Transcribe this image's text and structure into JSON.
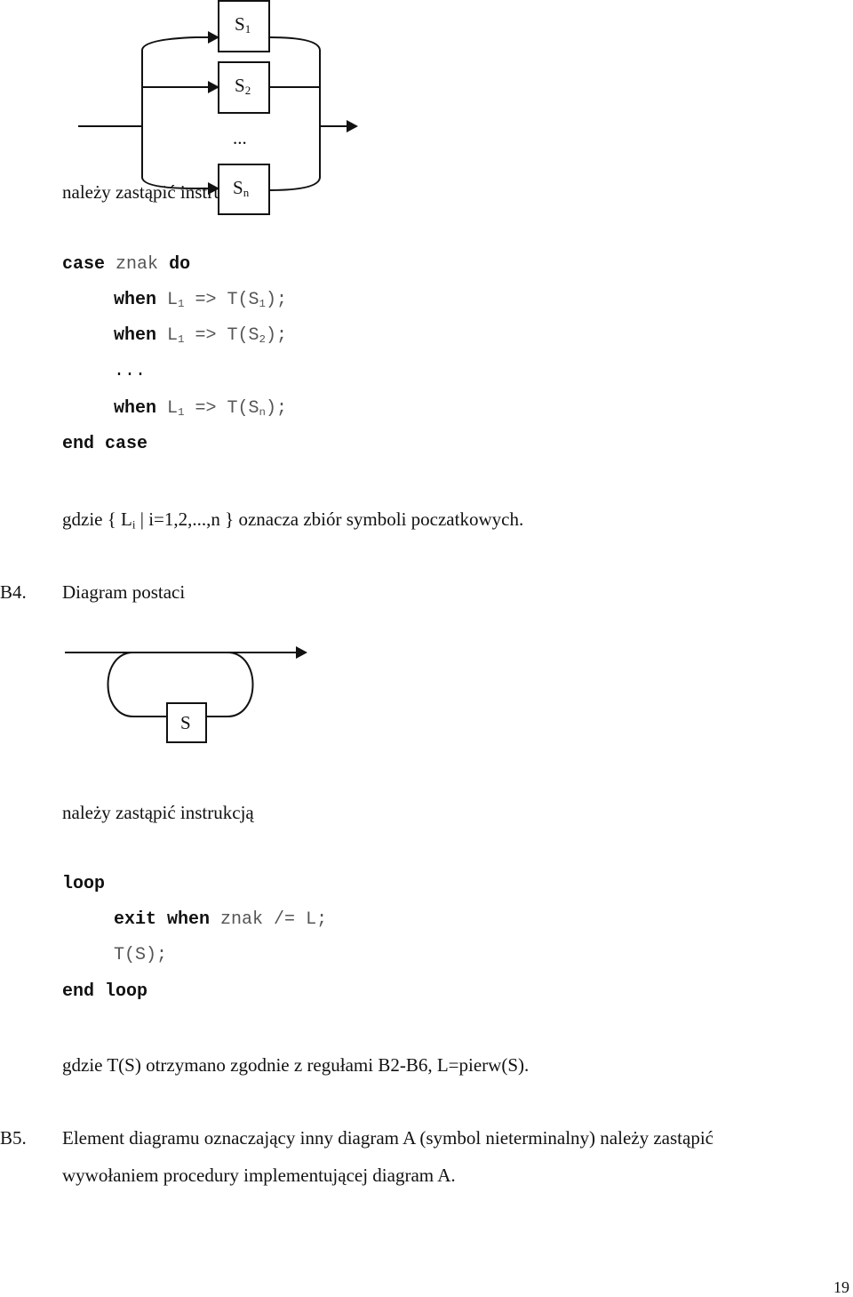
{
  "top_text": {
    "replace_instruction": "należy zastąpić instrukcją"
  },
  "diagram_alternative": {
    "boxes": [
      {
        "base": "S",
        "sub": "1"
      },
      {
        "base": "S",
        "sub": "2"
      },
      {
        "base": "S",
        "sub": "n"
      }
    ],
    "ellipsis": "..."
  },
  "case_code": {
    "line1": {
      "kw1": "case",
      "id": "znak",
      "kw2": "do"
    },
    "whens": [
      {
        "kw": "when",
        "L": "L",
        "Lsub": "1",
        "arrow": "=>",
        "T": "T(S",
        "Ssub": "1",
        "end": ");"
      },
      {
        "kw": "when",
        "L": "L",
        "Lsub": "1",
        "arrow": "=>",
        "T": "T(S",
        "Ssub": "2",
        "end": ");"
      },
      {
        "kw": "when",
        "L": "L",
        "Lsub": "1",
        "arrow": "=>",
        "T": "T(S",
        "Ssub": "n",
        "end": ");"
      }
    ],
    "ellipsis": "...",
    "end": "end case"
  },
  "case_note": {
    "prefix": "gdzie { L",
    "sub": "i",
    "suffix": " | i=1,2,...,n } oznacza zbiór symboli poczatkowych."
  },
  "b4": {
    "label": "B4.",
    "title": "Diagram postaci",
    "box_label": "S",
    "replace_instruction": "należy zastąpić instrukcją",
    "code": {
      "loop": "loop",
      "exit_kw": "exit when",
      "exit_rest": "znak /= L;",
      "body": "T(S);",
      "end": "end loop"
    },
    "note": "gdzie T(S) otrzymano zgodnie z regułami B2-B6, L=pierw(S)."
  },
  "b5": {
    "label": "B5.",
    "line1": "Element diagramu oznaczający inny diagram A (symbol nieterminalny) należy zastąpić",
    "line2": "wywołaniem procedury implementującej diagram A."
  },
  "page_number": "19"
}
